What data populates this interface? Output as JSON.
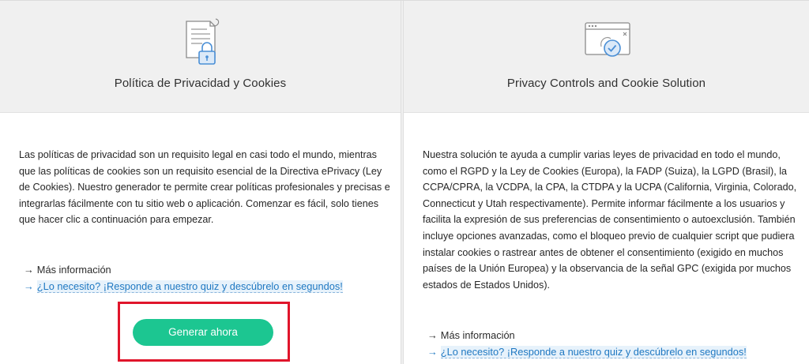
{
  "left_card": {
    "icon": "privacy-policy-document-lock-icon",
    "title": "Política de Privacidad y Cookies",
    "description": "Las políticas de privacidad son un requisito legal en casi todo el mundo, mientras que las políticas de cookies son un requisito esencial de la Directiva ePrivacy (Ley de Cookies). Nuestro generador te permite crear políticas profesionales y precisas e integrarlas fácilmente con tu sitio web o aplicación. Comenzar es fácil, solo tienes que hacer clic a continuación para empezar.",
    "more_info_arrow": "→",
    "more_info_label": "Más información",
    "quiz_arrow": "→",
    "quiz_label": "¿Lo necesito? ¡Responde a nuestro quiz y descúbrelo en segundos!",
    "cta_label": "Generar ahora"
  },
  "right_card": {
    "icon": "browser-window-checkmark-icon",
    "title": "Privacy Controls and Cookie Solution",
    "description": "Nuestra solución te ayuda a cumplir varias leyes de privacidad en todo el mundo, como el RGPD y la Ley de Cookies (Europa), la FADP (Suiza), la LGPD (Brasil), la CCPA/CPRA, la VCDPA, la CPA, la CTDPA y la UCPA (California, Virginia, Colorado, Connecticut y Utah respectivamente). Permite informar fácilmente a los usuarios y facilita la expresión de sus preferencias de consentimiento o autoexclusión. También incluye opciones avanzadas, como el bloqueo previo de cualquier script que pudiera instalar cookies o rastrear antes de obtener el consentimiento (exigido en muchos países de la Unión Europea) y la observancia de la señal GPC (exigida por muchos estados de Estados Unidos).",
    "more_info_arrow": "→",
    "more_info_label": "Más información",
    "quiz_arrow": "→",
    "quiz_label": "¿Lo necesito? ¡Responde a nuestro quiz y descúbrelo en segundos!"
  },
  "colors": {
    "cta_green": "#1cc691",
    "highlight_red": "#e0152b",
    "link_blue": "#1f78c2",
    "icon_blue": "#4a8fd6",
    "header_gray": "#f0f0f0"
  }
}
